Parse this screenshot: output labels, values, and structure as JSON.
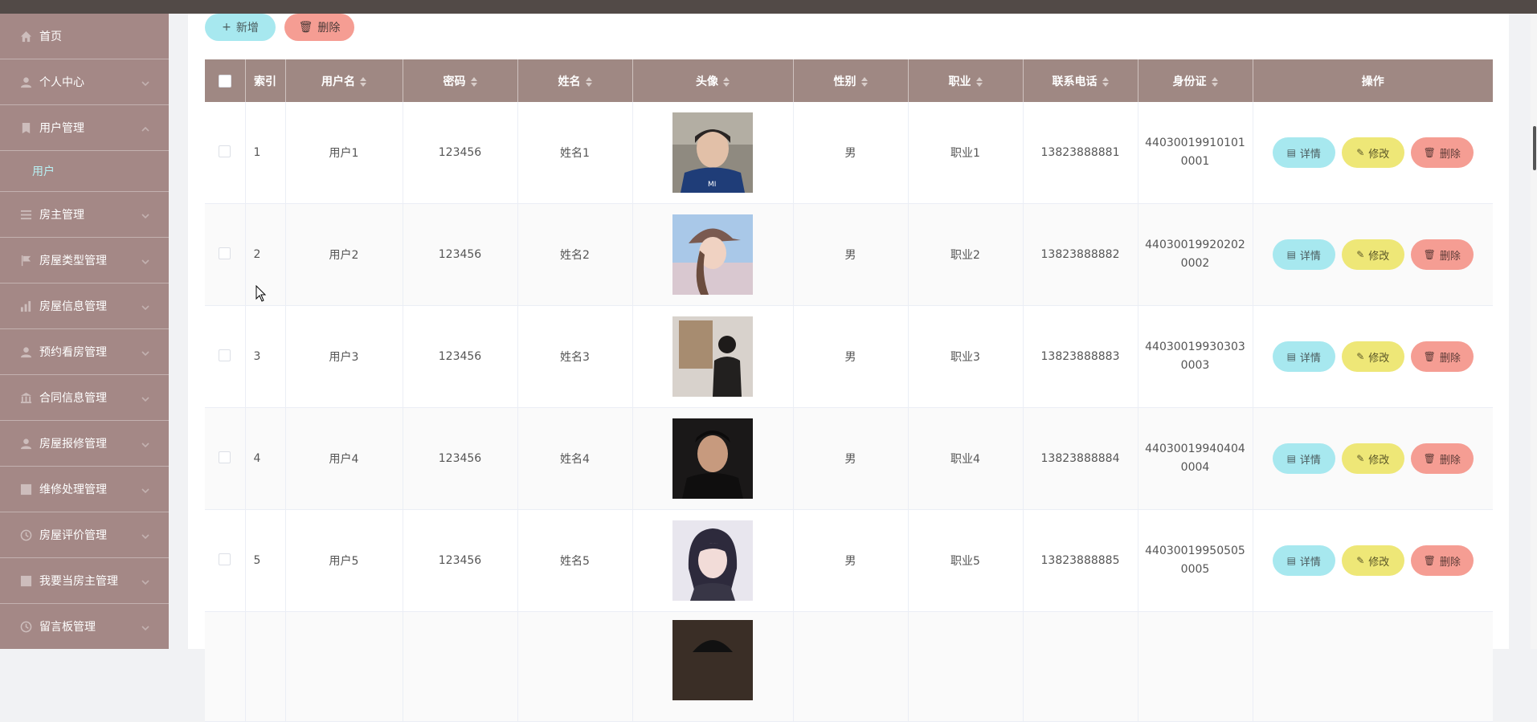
{
  "sidebar": {
    "items": [
      {
        "label": "首页",
        "icon": "home-icon"
      },
      {
        "label": "个人中心",
        "icon": "user-icon"
      },
      {
        "label": "用户管理",
        "icon": "user-manage-icon"
      },
      {
        "label": "房主管理",
        "icon": "list-icon"
      },
      {
        "label": "房屋类型管理",
        "icon": "flag-icon"
      },
      {
        "label": "房屋信息管理",
        "icon": "chart-icon"
      },
      {
        "label": "预约看房管理",
        "icon": "user-icon"
      },
      {
        "label": "合同信息管理",
        "icon": "bank-icon"
      },
      {
        "label": "房屋报修管理",
        "icon": "user-icon"
      },
      {
        "label": "维修处理管理",
        "icon": "grid-icon"
      },
      {
        "label": "房屋评价管理",
        "icon": "clock-icon"
      },
      {
        "label": "我要当房主管理",
        "icon": "grid-icon"
      },
      {
        "label": "留言板管理",
        "icon": "clock-icon"
      }
    ],
    "sub_item": "用户"
  },
  "toolbar": {
    "add_label": "新增",
    "delete_label": "删除"
  },
  "table": {
    "headers": [
      "索引",
      "用户名",
      "密码",
      "姓名",
      "头像",
      "性别",
      "职业",
      "联系电话",
      "身份证",
      "操作"
    ],
    "rows": [
      {
        "index": "1",
        "username": "用户1",
        "password": "123456",
        "name": "姓名1",
        "gender": "男",
        "job": "职业1",
        "phone": "13823888881",
        "id_line1": "44030019910101",
        "id_line2": "0001"
      },
      {
        "index": "2",
        "username": "用户2",
        "password": "123456",
        "name": "姓名2",
        "gender": "男",
        "job": "职业2",
        "phone": "13823888882",
        "id_line1": "44030019920202",
        "id_line2": "0002"
      },
      {
        "index": "3",
        "username": "用户3",
        "password": "123456",
        "name": "姓名3",
        "gender": "男",
        "job": "职业3",
        "phone": "13823888883",
        "id_line1": "44030019930303",
        "id_line2": "0003"
      },
      {
        "index": "4",
        "username": "用户4",
        "password": "123456",
        "name": "姓名4",
        "gender": "男",
        "job": "职业4",
        "phone": "13823888884",
        "id_line1": "44030019940404",
        "id_line2": "0004"
      },
      {
        "index": "5",
        "username": "用户5",
        "password": "123456",
        "name": "姓名5",
        "gender": "男",
        "job": "职业5",
        "phone": "13823888885",
        "id_line1": "44030019950505",
        "id_line2": "0005"
      }
    ],
    "actions": {
      "detail": "详情",
      "edit": "修改",
      "delete": "删除"
    }
  },
  "colors": {
    "sidebar_bg": "#a48886",
    "header_bg": "#9f8883",
    "detail_btn": "#a7e8ef",
    "edit_btn": "#eee777",
    "delete_btn": "#f59d93"
  }
}
